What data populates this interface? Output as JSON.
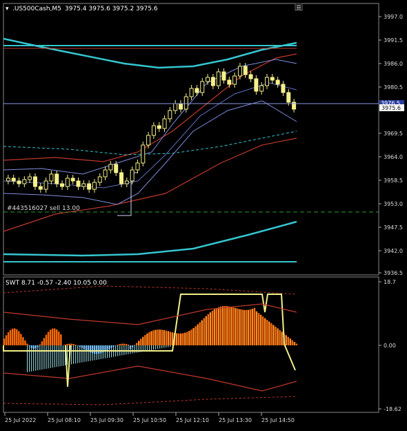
{
  "header": {
    "symbol": ".US500Cash,M5",
    "ohlc": "3975.4 3975.6 3975.2 3975.6"
  },
  "price_axis": {
    "labels": [
      "3997.0",
      "3991.5",
      "3986.0",
      "3980.5",
      "3975.6",
      "3969.5",
      "3964.0",
      "3958.5",
      "3953.0",
      "3947.5",
      "3942.0",
      "3936.5"
    ],
    "current_price": "3975.6",
    "prev_tag": "3976.5"
  },
  "order_line_label": "#443516027 sell 13.00",
  "indicator": {
    "label": "SWT 8.71 -0.57 -2.40 10.05 0.00",
    "axis_labels": [
      "18.7",
      "0.00",
      "-18.62"
    ]
  },
  "time_axis": {
    "labels": [
      "25 Jul 2022",
      "25 Jul 08:10",
      "25 Jul 09:30",
      "25 Jul 10:50",
      "25 Jul 12:10",
      "25 Jul 13:30",
      "25 Jul 14:50"
    ]
  },
  "colors": {
    "background": "#000000",
    "candles": "#f5f08a",
    "cyan_band": "#35c6cf",
    "red_line": "#c0392b",
    "blue_band": "#7f8fe0",
    "current_price_line": "#8a9ae6",
    "order_line": "#2e9b2e",
    "hist_orange": "#ff6a00",
    "hist_blue": "#4a8be0",
    "hist_cyan": "#9fe8ee",
    "signal_yellow": "#f2ef8a"
  },
  "chart_data": {
    "type": "candlestick",
    "symbol": ".US500Cash",
    "timeframe": "M5",
    "ylim": [
      3935,
      3999
    ],
    "close": [
      3960,
      3959,
      3957,
      3958,
      3960,
      3956,
      3955,
      3958,
      3961,
      3957,
      3956,
      3959,
      3958,
      3956,
      3957,
      3955,
      3958,
      3960,
      3962,
      3964,
      3961,
      3957,
      3958,
      3962,
      3964,
      3968,
      3970,
      3973,
      3972,
      3975,
      3978,
      3979,
      3977,
      3980,
      3982,
      3981,
      3983,
      3984,
      3982,
      3985,
      3983,
      3982,
      3984,
      3986,
      3984,
      3983,
      3980,
      3982,
      3984,
      3983,
      3982,
      3980,
      3977,
      3975.6
    ],
    "indicator": {
      "name": "SWT",
      "values": [
        8.71,
        -0.57,
        -2.4,
        10.05,
        0.0
      ],
      "ylim": [
        -18.62,
        18.7
      ]
    }
  }
}
